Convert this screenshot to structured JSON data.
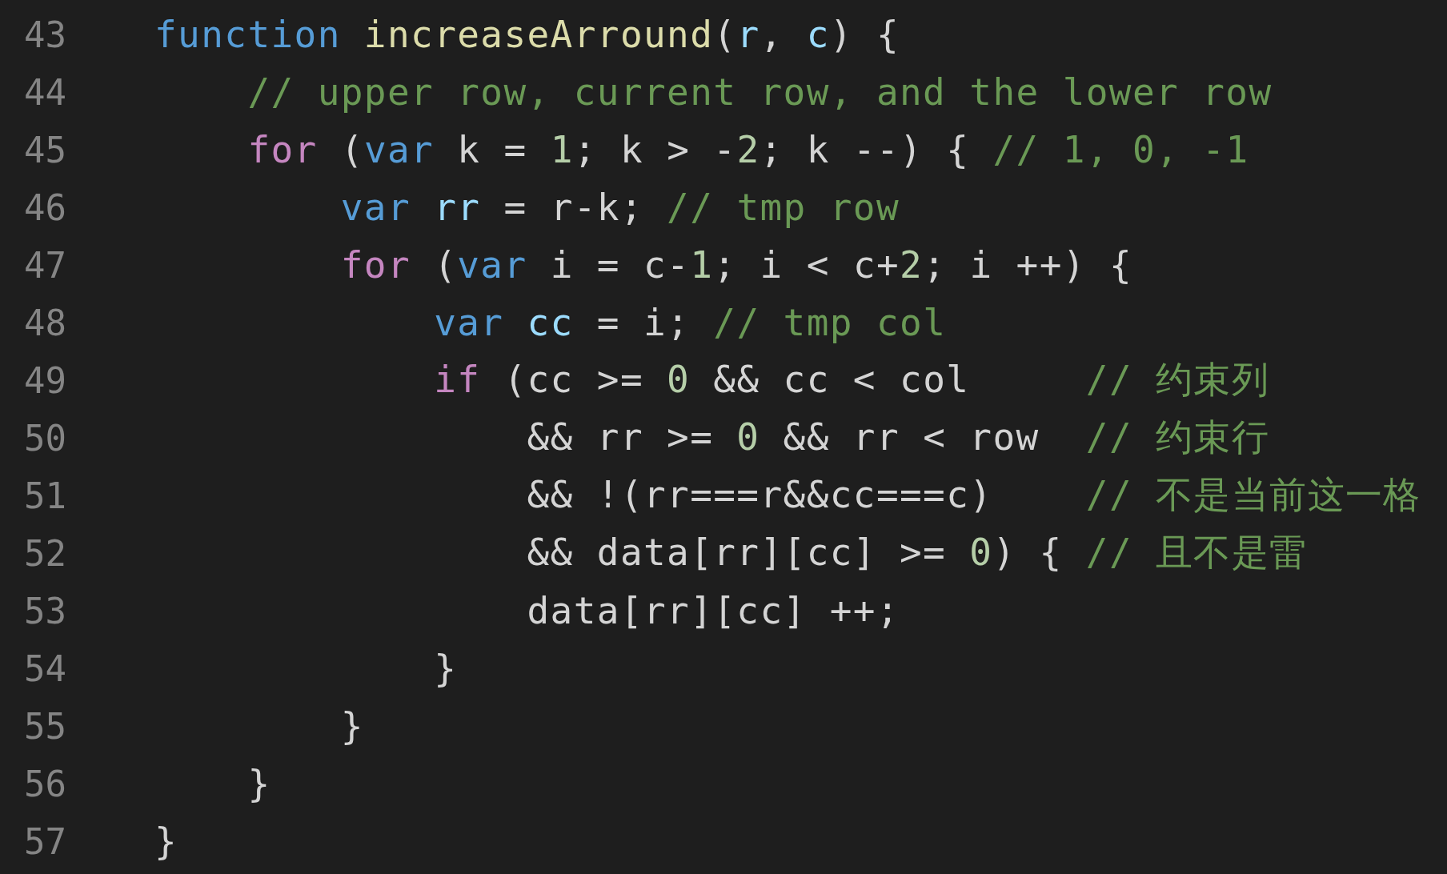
{
  "editor": {
    "lines": [
      {
        "number": "43",
        "tokens": [
          {
            "kind": "storage",
            "text": "function "
          },
          {
            "kind": "fn",
            "text": "increaseArround"
          },
          {
            "kind": "plain",
            "text": "("
          },
          {
            "kind": "param",
            "text": "r"
          },
          {
            "kind": "plain",
            "text": ", "
          },
          {
            "kind": "param",
            "text": "c"
          },
          {
            "kind": "plain",
            "text": ") {"
          }
        ]
      },
      {
        "number": "44",
        "tokens": [
          {
            "kind": "comment",
            "text": "    // upper row, current row, and the lower row"
          }
        ]
      },
      {
        "number": "45",
        "tokens": [
          {
            "kind": "keyword",
            "text": "    for"
          },
          {
            "kind": "plain",
            "text": " ("
          },
          {
            "kind": "storage",
            "text": "var"
          },
          {
            "kind": "plain",
            "text": " k = "
          },
          {
            "kind": "num",
            "text": "1"
          },
          {
            "kind": "plain",
            "text": "; k > -"
          },
          {
            "kind": "num",
            "text": "2"
          },
          {
            "kind": "plain",
            "text": "; k --) { "
          },
          {
            "kind": "comment",
            "text": "// 1, 0, -1"
          }
        ]
      },
      {
        "number": "46",
        "tokens": [
          {
            "kind": "storage",
            "text": "        var "
          },
          {
            "kind": "param",
            "text": "rr"
          },
          {
            "kind": "plain",
            "text": " = r-k; "
          },
          {
            "kind": "comment",
            "text": "// tmp row"
          }
        ]
      },
      {
        "number": "47",
        "tokens": [
          {
            "kind": "keyword",
            "text": "        for"
          },
          {
            "kind": "plain",
            "text": " ("
          },
          {
            "kind": "storage",
            "text": "var"
          },
          {
            "kind": "plain",
            "text": " i = c-"
          },
          {
            "kind": "num",
            "text": "1"
          },
          {
            "kind": "plain",
            "text": "; i < c+"
          },
          {
            "kind": "num",
            "text": "2"
          },
          {
            "kind": "plain",
            "text": "; i ++) {"
          }
        ]
      },
      {
        "number": "48",
        "tokens": [
          {
            "kind": "storage",
            "text": "            var "
          },
          {
            "kind": "param",
            "text": "cc"
          },
          {
            "kind": "plain",
            "text": " = i; "
          },
          {
            "kind": "comment",
            "text": "// tmp col"
          }
        ]
      },
      {
        "number": "49",
        "tokens": [
          {
            "kind": "keyword",
            "text": "            if"
          },
          {
            "kind": "plain",
            "text": " (cc >= "
          },
          {
            "kind": "num",
            "text": "0"
          },
          {
            "kind": "plain",
            "text": " && cc < col     "
          },
          {
            "kind": "comment",
            "text": "// 约束列"
          }
        ]
      },
      {
        "number": "50",
        "tokens": [
          {
            "kind": "plain",
            "text": "                && rr >= "
          },
          {
            "kind": "num",
            "text": "0"
          },
          {
            "kind": "plain",
            "text": " && rr < row  "
          },
          {
            "kind": "comment",
            "text": "// 约束行"
          }
        ]
      },
      {
        "number": "51",
        "tokens": [
          {
            "kind": "plain",
            "text": "                && !(rr===r&&cc===c)    "
          },
          {
            "kind": "comment",
            "text": "// 不是当前这一格"
          }
        ]
      },
      {
        "number": "52",
        "tokens": [
          {
            "kind": "plain",
            "text": "                && data[rr][cc] >= "
          },
          {
            "kind": "num",
            "text": "0"
          },
          {
            "kind": "plain",
            "text": ") { "
          },
          {
            "kind": "comment",
            "text": "// 且不是雷"
          }
        ]
      },
      {
        "number": "53",
        "tokens": [
          {
            "kind": "plain",
            "text": "                data[rr][cc] ++;"
          }
        ]
      },
      {
        "number": "54",
        "tokens": [
          {
            "kind": "plain",
            "text": "            }"
          }
        ]
      },
      {
        "number": "55",
        "tokens": [
          {
            "kind": "plain",
            "text": "        }"
          }
        ]
      },
      {
        "number": "56",
        "tokens": [
          {
            "kind": "plain",
            "text": "    }"
          }
        ]
      },
      {
        "number": "57",
        "tokens": [
          {
            "kind": "plain",
            "text": "}"
          }
        ]
      }
    ]
  }
}
